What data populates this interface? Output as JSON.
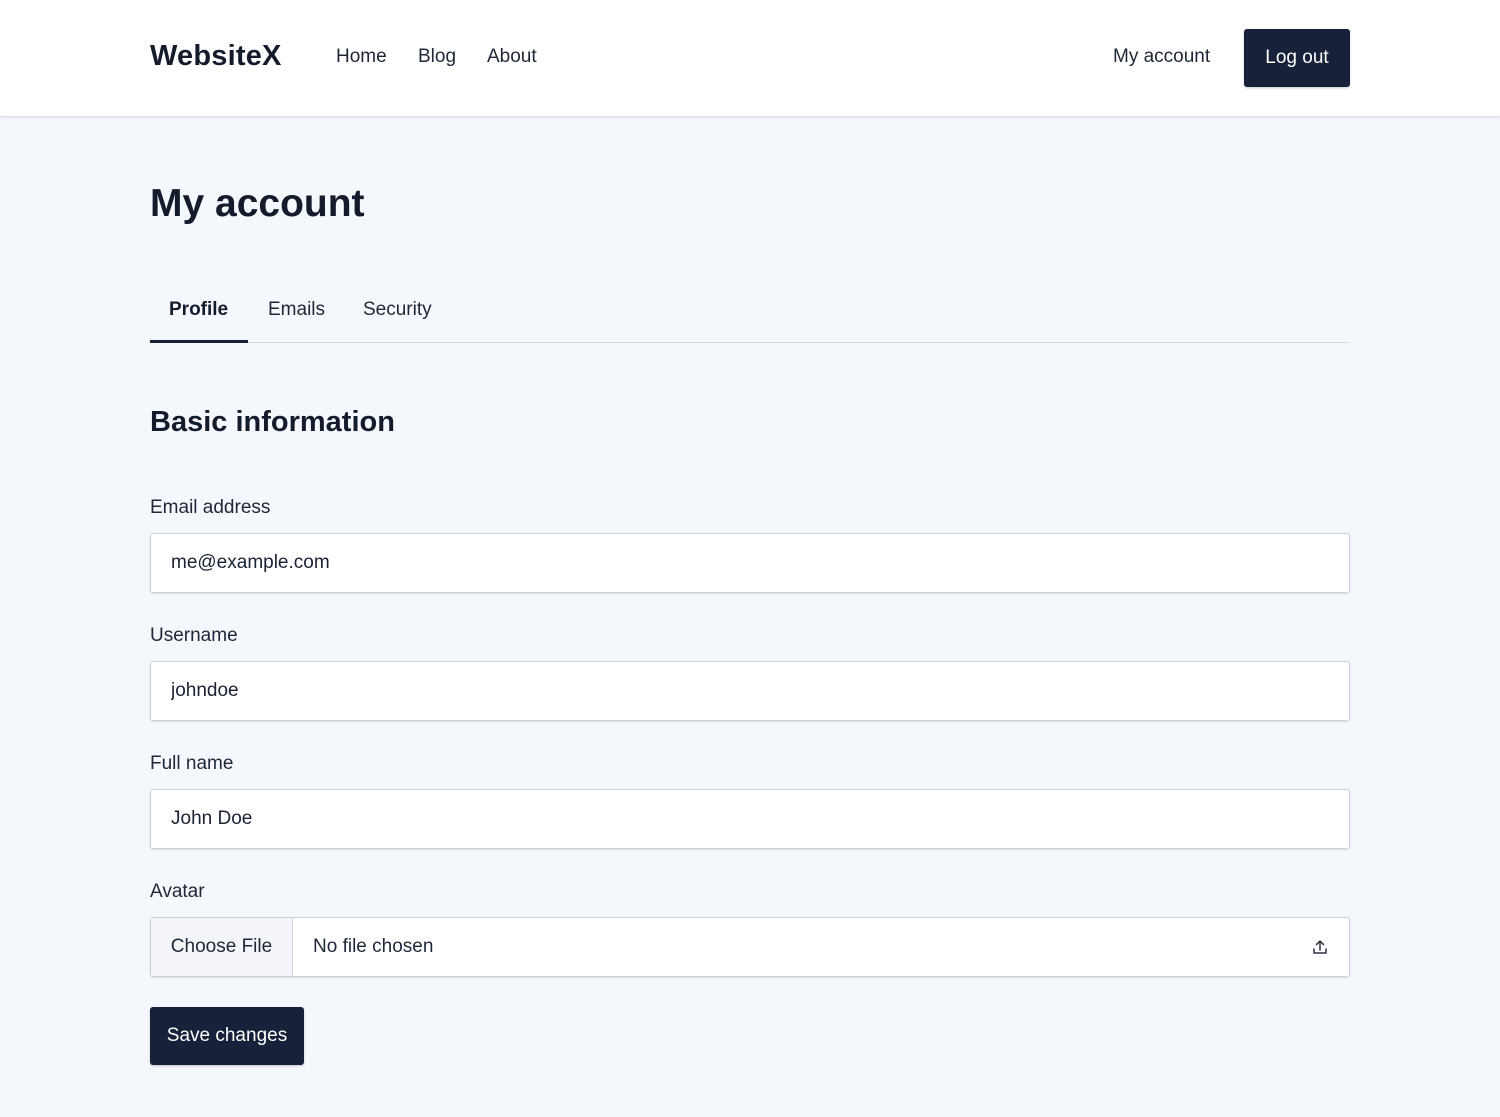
{
  "header": {
    "logo": "WebsiteX",
    "nav": [
      {
        "label": "Home"
      },
      {
        "label": "Blog"
      },
      {
        "label": "About"
      }
    ],
    "account_link": "My account",
    "logout_label": "Log out"
  },
  "page": {
    "title": "My account",
    "tabs": [
      {
        "label": "Profile",
        "active": true
      },
      {
        "label": "Emails",
        "active": false
      },
      {
        "label": "Security",
        "active": false
      }
    ],
    "section_title": "Basic information"
  },
  "form": {
    "email": {
      "label": "Email address",
      "value": "me@example.com"
    },
    "username": {
      "label": "Username",
      "value": "johndoe"
    },
    "fullname": {
      "label": "Full name",
      "value": "John Doe"
    },
    "avatar": {
      "label": "Avatar",
      "button_label": "Choose File",
      "status": "No file chosen",
      "icon": "upload-icon"
    },
    "save_label": "Save changes"
  },
  "colors": {
    "primary": "#17223a",
    "background": "#f4f7fb",
    "surface": "#ffffff"
  }
}
